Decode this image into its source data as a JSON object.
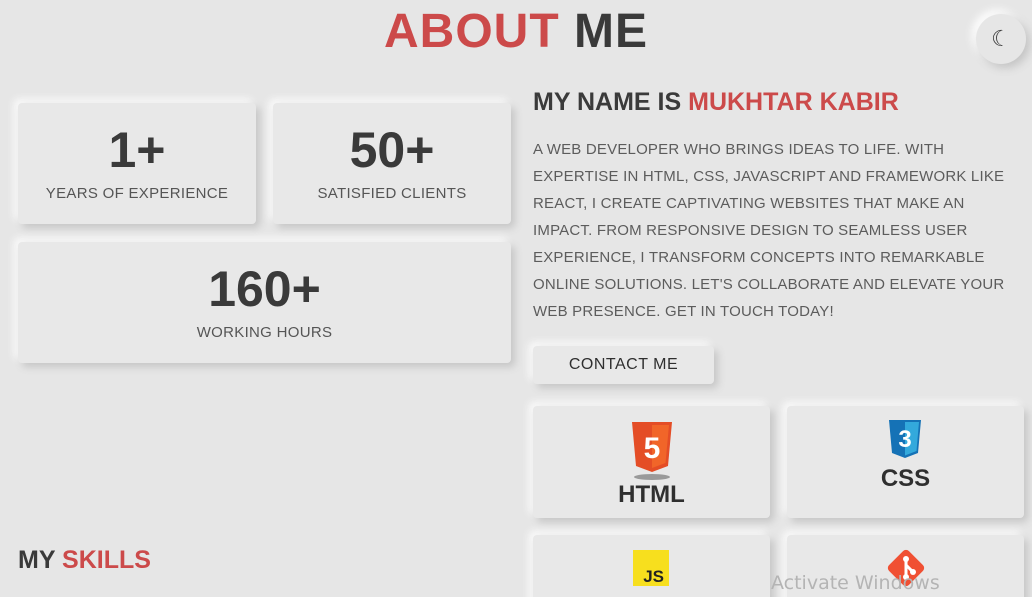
{
  "header": {
    "title_accent": "ABOUT",
    "title_rest": "ME"
  },
  "theme_toggle": {
    "icon": "moon-icon"
  },
  "stats": [
    {
      "number": "1+",
      "label": "YEARS OF EXPERIENCE"
    },
    {
      "number": "50+",
      "label": "SATISFIED CLIENTS"
    },
    {
      "number": "160+",
      "label": "WORKING HOURS"
    }
  ],
  "intro": {
    "prefix": "MY NAME IS",
    "name": "MUKHTAR KABIR",
    "bio": "A WEB DEVELOPER WHO BRINGS IDEAS TO LIFE. WITH EXPERTISE IN HTML, CSS, JAVASCRIPT AND FRAMEWORK LIKE REACT, I CREATE CAPTIVATING WEBSITES THAT MAKE AN IMPACT. FROM RESPONSIVE DESIGN TO SEAMLESS USER EXPERIENCE, I TRANSFORM CONCEPTS INTO REMARKABLE ONLINE SOLUTIONS. LET'S COLLABORATE AND ELEVATE YOUR WEB PRESENCE. GET IN TOUCH TODAY!",
    "contact_button": "CONTACT ME"
  },
  "skills": {
    "heading_prefix": "MY",
    "heading_accent": "SKILLS",
    "items": [
      {
        "label": "HTML",
        "icon": "html5-icon",
        "badge": "5"
      },
      {
        "label": "CSS",
        "icon": "css3-icon",
        "badge": "3"
      },
      {
        "label": "",
        "icon": "javascript-icon",
        "badge": "JS"
      },
      {
        "label": "",
        "icon": "git-icon",
        "badge": ""
      }
    ]
  },
  "watermark": "Activate Windows",
  "colors": {
    "accent": "#cc4a4a",
    "background": "#e6e6e6",
    "text": "#3a3a3a"
  }
}
